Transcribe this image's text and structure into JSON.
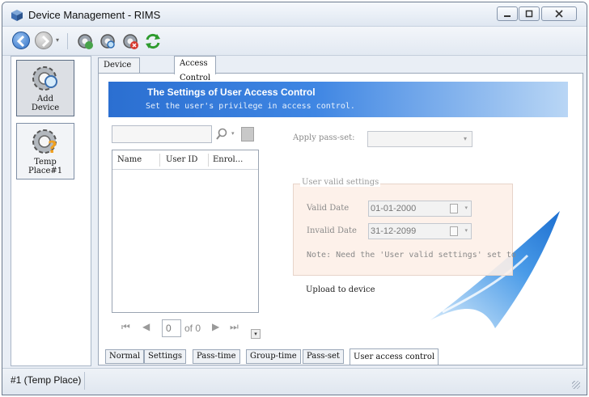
{
  "window": {
    "title": "Device Management - RIMS",
    "min_glyph": "▭",
    "max_glyph": "▢",
    "close_glyph": "✕"
  },
  "toolbar": {
    "back_glyph": "◀",
    "forward_glyph": "▶",
    "dropdown_glyph": "▾",
    "icons": [
      "back-icon",
      "forward-icon",
      "device-connect-icon",
      "device-search-icon",
      "device-delete-icon",
      "refresh-icon"
    ]
  },
  "devices": [
    {
      "label": "Add Device",
      "icon": "gear-search-icon",
      "active": true
    },
    {
      "label": "Temp Place#1",
      "icon": "gear-question-icon",
      "active": false
    }
  ],
  "outer_tabs": [
    {
      "label": "Device Control",
      "active": false
    },
    {
      "label": "Access Control",
      "active": true
    }
  ],
  "banner": {
    "title": "The Settings of User Access Control",
    "subtitle": "Set the user's privilege in access control."
  },
  "search": {
    "value": "",
    "drop_glyph": "▾"
  },
  "grid": {
    "columns": [
      "Name",
      "User ID",
      "Enrol..."
    ],
    "rows": []
  },
  "pager": {
    "first": "⏮",
    "prev": "◀",
    "page_value": "0",
    "of_text": "of 0",
    "next": "▶",
    "last": "⏭",
    "menu_glyph": "▾"
  },
  "apply": {
    "label": "Apply pass-set:",
    "value": "",
    "caret": "▾"
  },
  "valid_settings": {
    "title": "User valid settings",
    "valid_label": "Valid Date",
    "valid_value": "01-01-2000",
    "invalid_label": "Invalid Date",
    "invalid_value": "31-12-2099",
    "caret": "▾",
    "note": "Note: Need the 'User valid settings' set to"
  },
  "upload_label": "Upload to device",
  "inner_tabs": [
    {
      "label": "Normal",
      "active": false
    },
    {
      "label": "Settings",
      "active": false
    },
    {
      "label": "Pass-time",
      "active": false
    },
    {
      "label": "Group-time",
      "active": false
    },
    {
      "label": "Pass-set",
      "active": false
    },
    {
      "label": "User access control",
      "active": true
    }
  ],
  "status": {
    "text": "#1 (Temp Place)"
  },
  "colors": {
    "banner_start": "#2b6fd1",
    "banner_end": "#b9d6f5",
    "swoosh": "#3a8de0"
  }
}
